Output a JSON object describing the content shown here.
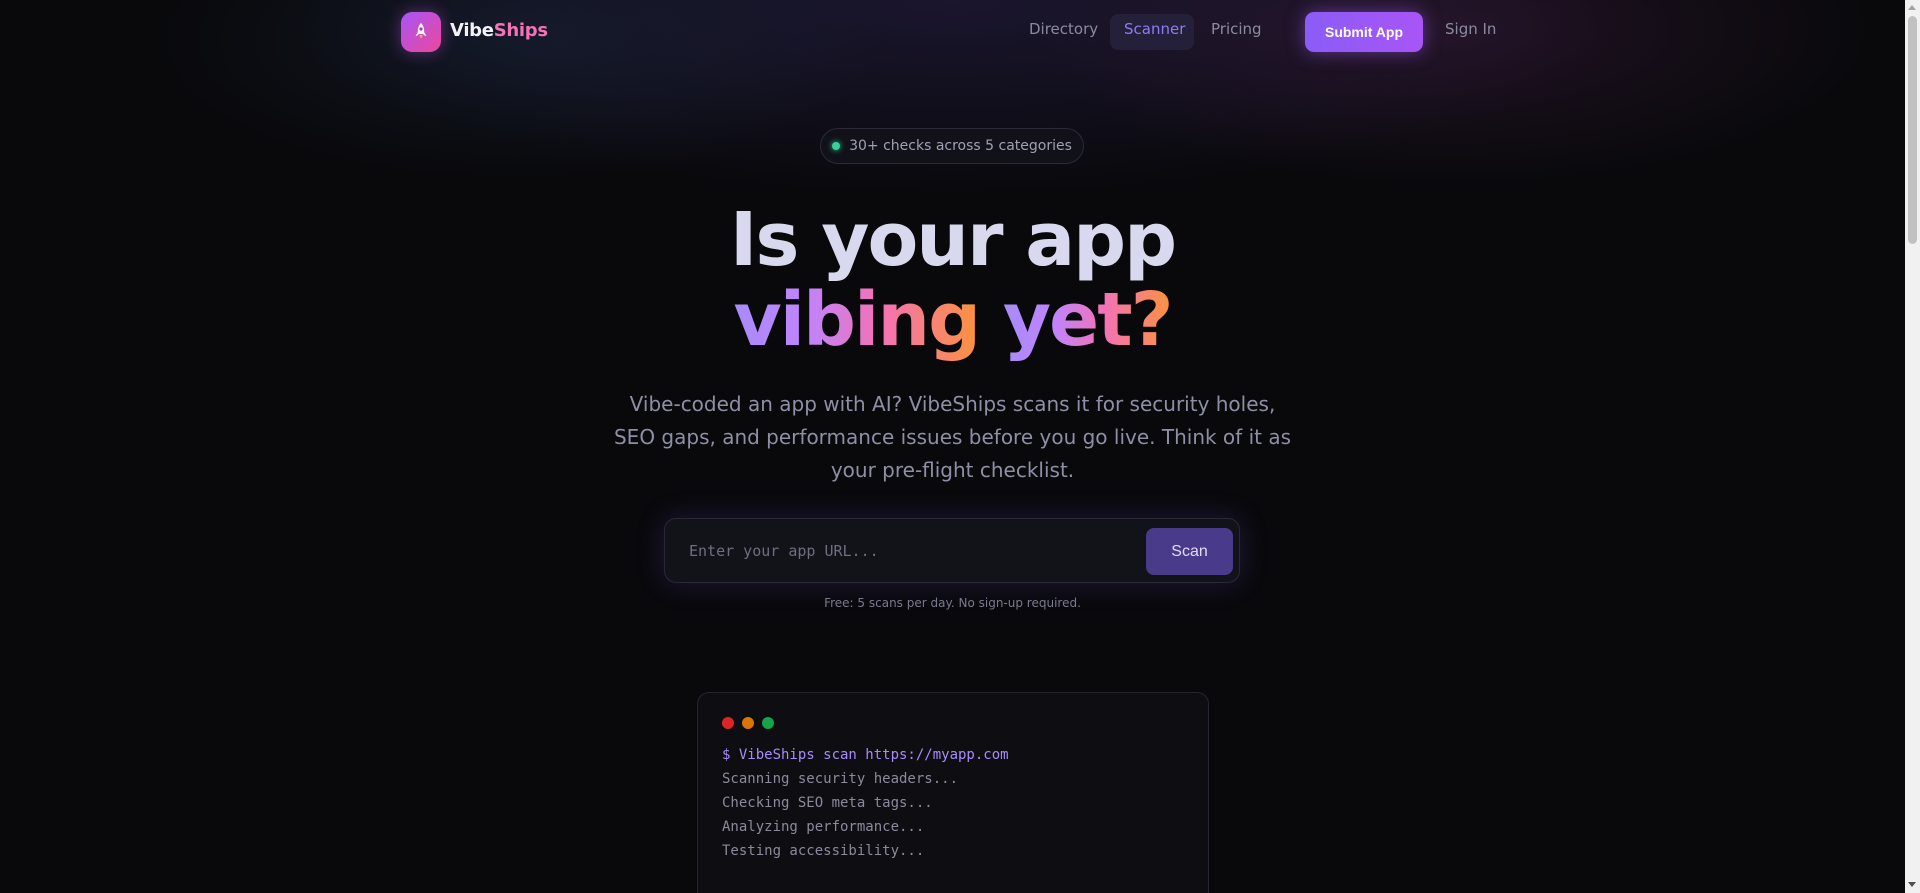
{
  "nav": {
    "brand_part1": "Vibe",
    "brand_part2": "Ships",
    "links": [
      {
        "label": "Directory"
      },
      {
        "label": "Scanner"
      },
      {
        "label": "Pricing"
      }
    ],
    "active_link": "Scanner",
    "submit_label": "Submit App",
    "signin_label": "Sign In"
  },
  "badge": {
    "text": "30+ checks across 5 categories"
  },
  "hero": {
    "line1": "Is your app",
    "line2_a": "vibing",
    "line2_b": "yet?",
    "subtitle": "Vibe-coded an app with AI? VibeShips scans it for security holes, SEO gaps, and performance issues before you go live. Think of it as your pre-flight checklist."
  },
  "scan": {
    "placeholder": "Enter your app URL...",
    "button_label": "Scan",
    "note": "Free: 5 scans per day. No sign-up required."
  },
  "terminal": {
    "command": "$ VibeShips scan https://myapp.com",
    "lines": [
      "Scanning security headers...",
      "Checking SEO meta tags...",
      "Analyzing performance...",
      "Testing accessibility..."
    ]
  },
  "colors": {
    "accent": "#8b5cf6",
    "status_dot": "#34d399",
    "terminal_red": "#dc2626",
    "terminal_yellow": "#d97706",
    "terminal_green": "#16a34a"
  }
}
